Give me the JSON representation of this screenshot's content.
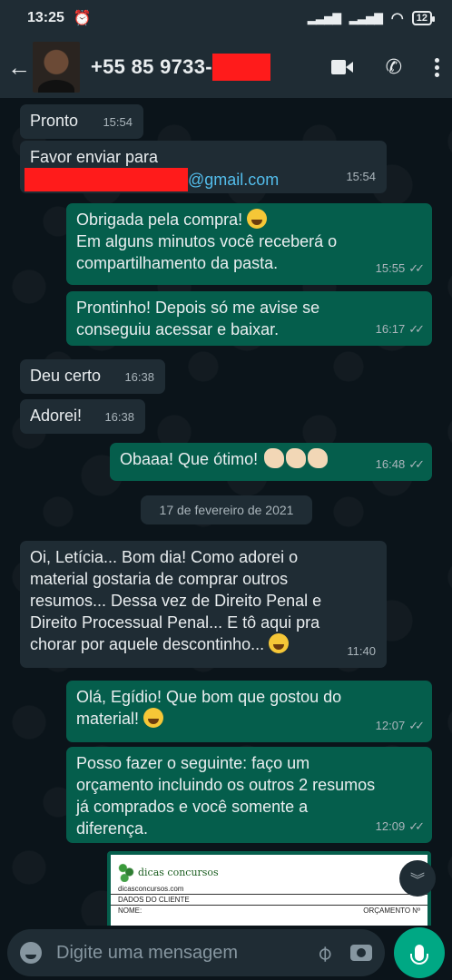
{
  "status_bar": {
    "time": "13:25",
    "battery": "12"
  },
  "header": {
    "contact_number": "+55 85 9733-"
  },
  "messages": [
    {
      "text": "Pronto",
      "time": "15:54"
    },
    {
      "line1": "Favor enviar para",
      "email_suffix": "@gmail.com",
      "time": "15:54"
    },
    {
      "line1": "Obrigada pela compra!",
      "line2": "Em alguns minutos você receberá o",
      "line3": "compartilhamento da pasta.",
      "time": "15:55"
    },
    {
      "line1": "Prontinho! Depois só me avise se",
      "line2": "conseguiu acessar e baixar.",
      "time": "16:17"
    },
    {
      "text": "Deu certo",
      "time": "16:38"
    },
    {
      "text": "Adorei!",
      "time": "16:38"
    },
    {
      "text": "Obaaa! Que ótimo!",
      "time": "16:48"
    },
    {
      "line1": "Oi, Letícia... Bom dia! Como adorei o",
      "line2": "material gostaria de comprar outros",
      "line3": "resumos... Dessa vez de Direito Penal e",
      "line4": "Direito Processual Penal... E tô aqui pra",
      "line5": "chorar por aquele descontinho...",
      "time": "11:40"
    },
    {
      "line1": "Olá, Egídio! Que bom que gostou do",
      "line2": "material!",
      "time": "12:07"
    },
    {
      "line1": "Posso fazer o seguinte: faço um",
      "line2": "orçamento incluindo os outros 2 resumos",
      "line3": "já comprados e você somente a",
      "line4": "diferença.",
      "time": "12:09"
    }
  ],
  "date_divider": "17 de fevereiro de 2021",
  "attachment": {
    "logo_text": "dicas concursos",
    "site": "dicasconcursos.com",
    "section": "DADOS DO CLIENTE",
    "field": "NOME:",
    "right_label": "ORÇAMENTO Nº"
  },
  "input": {
    "placeholder": "Digite uma mensagem"
  },
  "colors": {
    "outgoing": "#055e4c",
    "incoming": "#1f2c34",
    "accent": "#00a884",
    "redaction": "#ff1b1b"
  }
}
